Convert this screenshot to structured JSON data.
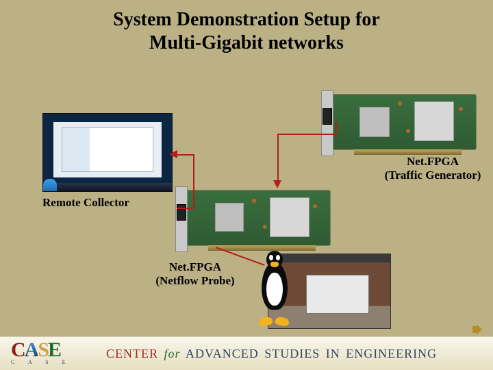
{
  "title_line1": "System Demonstration Setup for",
  "title_line2": "Multi-Gigabit networks",
  "remote_collector_label": "Remote Collector",
  "traffic_generator_line1": "Net.FPGA",
  "traffic_generator_line2": "(Traffic Generator)",
  "netflow_probe_line1": "Net.FPGA",
  "netflow_probe_line2": "(Netflow Probe)",
  "footer": {
    "logo_top": "CASE",
    "logo_bottom_spaced": "C  A  S  E",
    "center_pre": "CENTER ",
    "center_for": "for",
    "center_post": " ADVANCED STUDIES IN ENGINEERING"
  },
  "icons": {
    "speaker": "speaker-icon",
    "penguin": "tux-penguin-icon"
  },
  "colors": {
    "background": "#bcb085",
    "arrow": "#b22018",
    "pcb": "#3a6e3e"
  }
}
